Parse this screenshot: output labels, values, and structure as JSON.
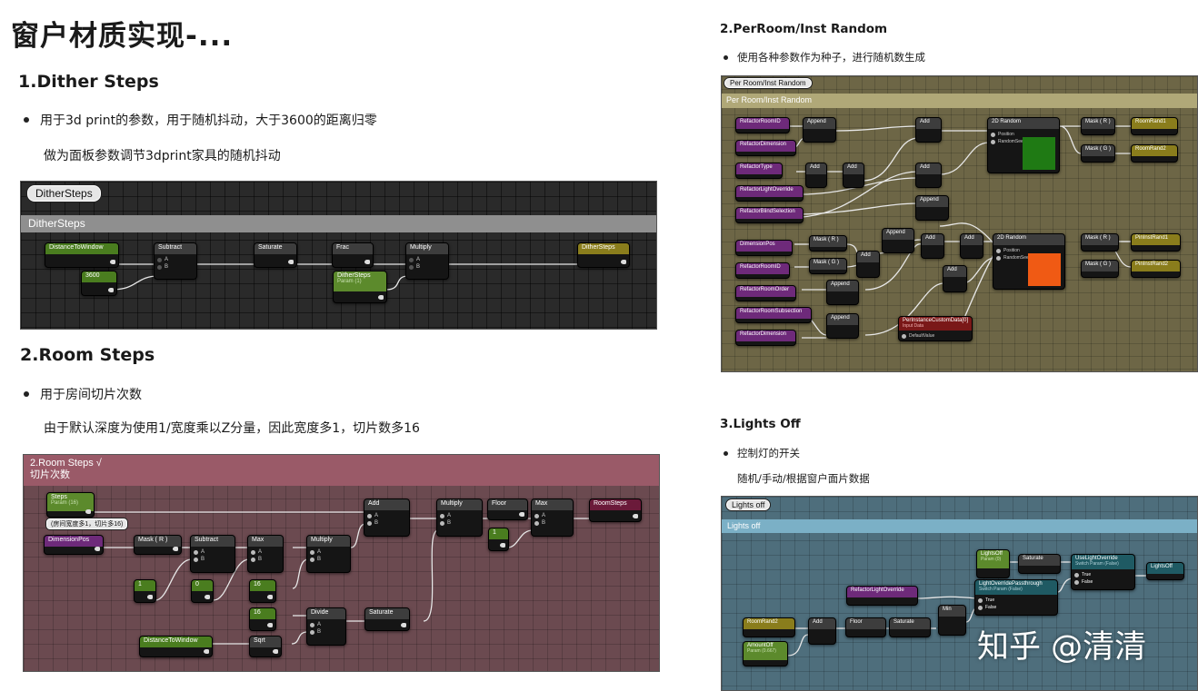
{
  "page": {
    "title": "窗户材质实现-...",
    "watermark": "知乎 @清清"
  },
  "sec_dither": {
    "heading": "1.Dither Steps",
    "bullet": "用于3d print的参数，用于随机抖动，大于3600的距离归零",
    "note": "做为面板参数调节3dprint家具的随机抖动",
    "graph": {
      "tag": "DitherSteps",
      "comment": "DitherSteps",
      "nodes": {
        "distance": "DistanceToWindow",
        "const3600": "3600",
        "subtract": "Subtract",
        "saturate": "Saturate",
        "frac": "Frac",
        "dither_param": "DitherSteps",
        "dither_param_sub": "Param (1)",
        "multiply": "Multiply",
        "output": "DitherSteps"
      }
    }
  },
  "sec_room": {
    "heading": "2.Room Steps",
    "bullet": "用于房间切片次数",
    "note": "由于默认深度为使用1/宽度乘以Z分量，因此宽度多1，切片数多16",
    "graph": {
      "comment_title": "2.Room Steps √",
      "comment_sub": "切片次数",
      "annotation": "(房间宽度多1，切片多16)",
      "nodes": {
        "steps": "Steps",
        "steps_sub": "Param (16)",
        "dimension_pos": "DimensionPos",
        "mask_r": "Mask ( R )",
        "subtract": "Subtract",
        "max1": "Max",
        "multiply1": "Multiply",
        "add": "Add",
        "multiply2": "Multiply",
        "floor": "Floor",
        "max2": "Max",
        "room_steps": "RoomSteps",
        "c1": "1",
        "c0": "0",
        "c16a": "16",
        "c16b": "16",
        "c1b": "1",
        "divide": "Divide",
        "saturate": "Saturate",
        "distance": "DistanceToWindow",
        "sqrt": "Sqrt"
      }
    }
  },
  "sec_perroom": {
    "heading": "2.PerRoom/Inst Random",
    "bullet": "使用各种参数作为种子，进行随机数生成",
    "graph": {
      "tag": "Per Room/Inst Random",
      "comment": "Per Room/Inst Random",
      "nodes": {
        "rf_room_id": "RefactorRoomID",
        "rf_dimension": "RefactorDimension",
        "rf_type": "RefactorType",
        "rf_light_override": "RefactorLightOverride",
        "rf_blind": "RefactorBlindSelection",
        "dimension_pos": "DimensionPos",
        "rf_room_id2": "RefactorRoomID",
        "rf_room_order": "RefactorRoomOrder",
        "rf_room_subsection": "RefactorRoomSubsection",
        "rf_dimension2": "RefactorDimension",
        "append1": "Append",
        "add1": "Add",
        "add2": "Add",
        "random1": "2D Random",
        "random1_pos": "Position",
        "random1_seed": "RandomSeed",
        "mask_r1": "Mask ( R )",
        "mask_g1": "Mask ( G )",
        "room_rand1": "RoomRand1",
        "room_rand2": "RoomRand2",
        "add3": "Add",
        "add4": "Add",
        "append2": "Append",
        "mask_r2": "Mask ( R )",
        "mask_g2": "Mask ( G )",
        "append3": "Append",
        "append4": "Append",
        "append5": "Append",
        "add5": "Add",
        "add6": "Add",
        "add7": "Add",
        "random2": "2D Random",
        "random2_pos": "Position",
        "random2_seed": "RandomSeed",
        "mask_r3": "Mask ( R )",
        "mask_g3": "Mask ( G )",
        "pinst_rand1": "PinInstRand1",
        "pinst_rand2": "PinInstRand2",
        "custom_data": "PerInstanceCustomData[0]",
        "custom_data_sub": "Input Data",
        "default_value": "DefaultValue"
      },
      "swatch1": "#1f7a14",
      "swatch2": "#f05a14"
    }
  },
  "sec_lights": {
    "heading": "3.Lights Off",
    "bullet": "控制灯的开关",
    "note": "随机/手动/根据窗户面片数据",
    "graph": {
      "tag": "Lights off",
      "comment": "Lights off",
      "nodes": {
        "lights_off_param": "LightsOff",
        "lights_off_param_sub": "Param (0)",
        "saturate1": "Saturate",
        "use_light_override": "UseLightOverride",
        "use_light_override_sub": "Switch Param (False)",
        "true1": "True",
        "false1": "False",
        "output": "LightsOff",
        "rf_light_override": "RefactorLightOverride",
        "passthrough": "LightOverridePassthrough",
        "passthrough_sub": "Switch Param (False)",
        "true2": "True",
        "false2": "False",
        "room_rand2": "RoomRand2",
        "add": "Add",
        "floor": "Floor",
        "saturate2": "Saturate",
        "min": "Min",
        "amount_off": "AmountOff",
        "amount_off_sub": "Param (0.667)"
      }
    }
  }
}
